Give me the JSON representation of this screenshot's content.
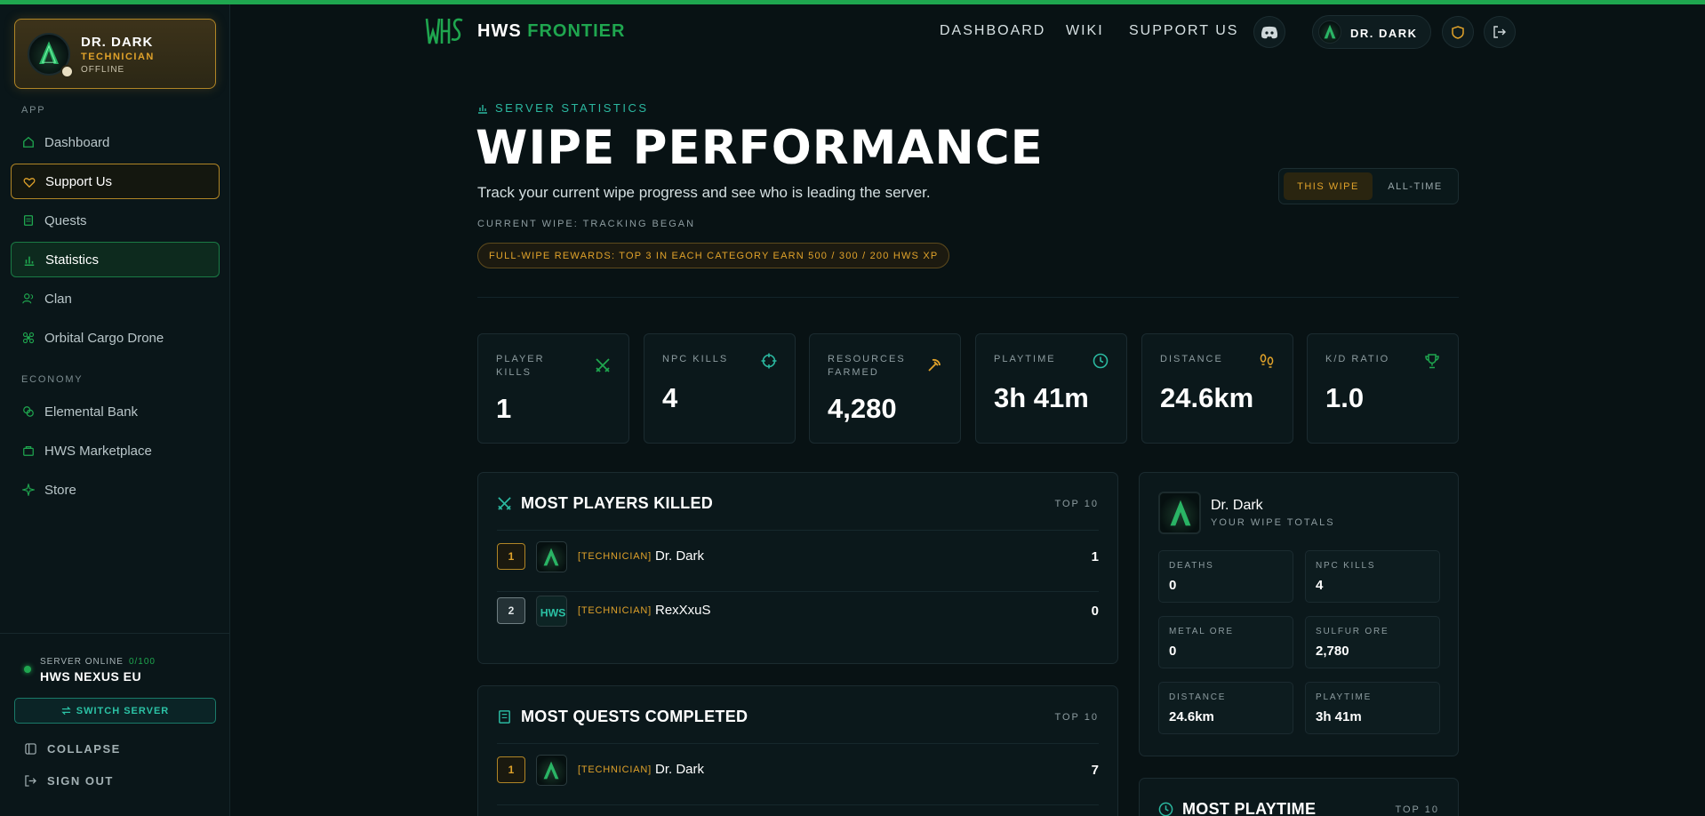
{
  "sidebar": {
    "profile": {
      "name": "DR. DARK",
      "role": "TECHNICIAN",
      "status": "OFFLINE"
    },
    "sections": [
      {
        "label": "APP",
        "items": [
          {
            "label": "Dashboard",
            "icon": "home-icon"
          },
          {
            "label": "Support Us",
            "icon": "heart-icon"
          },
          {
            "label": "Quests",
            "icon": "scroll-icon"
          },
          {
            "label": "Statistics",
            "icon": "bar-chart-icon"
          },
          {
            "label": "Clan",
            "icon": "users-icon"
          },
          {
            "label": "Orbital Cargo Drone",
            "icon": "drone-icon"
          }
        ]
      },
      {
        "label": "ECONOMY",
        "items": [
          {
            "label": "Elemental Bank",
            "icon": "coins-icon"
          },
          {
            "label": "HWS Marketplace",
            "icon": "bag-icon"
          },
          {
            "label": "Store",
            "icon": "sparkle-icon"
          }
        ]
      }
    ],
    "server": {
      "status": "SERVER ONLINE",
      "count": "0/100",
      "name": "HWS NEXUS EU",
      "switch_label": "SWITCH SERVER"
    },
    "collapse_label": "COLLAPSE",
    "signout_label": "SIGN OUT"
  },
  "topnav": {
    "logo_text": "HWS",
    "logo_accent": "FRONTIER",
    "links": [
      "DASHBOARD",
      "WIKI",
      "SUPPORT US"
    ],
    "user_name": "DR. DARK"
  },
  "header": {
    "eyebrow": "SERVER STATISTICS",
    "title": "WIPE PERFORMANCE",
    "subtitle": "Track your current wipe progress and see who is leading the server.",
    "tracking": "CURRENT WIPE: TRACKING BEGAN",
    "rewards": "FULL-WIPE REWARDS: TOP 3 IN EACH CATEGORY EARN 500 / 300 / 200 HWS XP",
    "toggle": {
      "active": "THIS WIPE",
      "inactive": "ALL-TIME"
    }
  },
  "stats": [
    {
      "label": "PLAYER KILLS",
      "value": "1",
      "icon": "swords-icon",
      "color": "#1fa64f"
    },
    {
      "label": "NPC KILLS",
      "value": "4",
      "icon": "crosshair-icon",
      "color": "#2bb8a0"
    },
    {
      "label": "RESOURCES FARMED",
      "value": "4,280",
      "icon": "pickaxe-icon",
      "color": "#e0a22a"
    },
    {
      "label": "PLAYTIME",
      "value": "3h 41m",
      "icon": "clock-icon",
      "color": "#2bb8a0"
    },
    {
      "label": "DISTANCE",
      "value": "24.6km",
      "icon": "footprints-icon",
      "color": "#e0a22a"
    },
    {
      "label": "K/D RATIO",
      "value": "1.0",
      "icon": "trophy-icon",
      "color": "#1fa64f"
    }
  ],
  "leaderboards": [
    {
      "title": "MOST PLAYERS KILLED",
      "badge": "TOP 10",
      "icon": "swords-icon",
      "rows": [
        {
          "rank": "1",
          "tag": "[TECHNICIAN]",
          "name": "Dr. Dark",
          "value": "1"
        },
        {
          "rank": "2",
          "tag": "[TECHNICIAN]",
          "name": "RexXxuS",
          "value": "0"
        }
      ]
    },
    {
      "title": "MOST QUESTS COMPLETED",
      "badge": "TOP 10",
      "icon": "scroll-icon",
      "rows": [
        {
          "rank": "1",
          "tag": "[TECHNICIAN]",
          "name": "Dr. Dark",
          "value": "7"
        }
      ]
    }
  ],
  "totals": {
    "name": "Dr. Dark",
    "subtitle": "YOUR WIPE TOTALS",
    "items": [
      {
        "label": "DEATHS",
        "value": "0"
      },
      {
        "label": "NPC KILLS",
        "value": "4"
      },
      {
        "label": "METAL ORE",
        "value": "0"
      },
      {
        "label": "SULFUR ORE",
        "value": "2,780"
      },
      {
        "label": "DISTANCE",
        "value": "24.6km"
      },
      {
        "label": "PLAYTIME",
        "value": "3h 41m"
      }
    ]
  },
  "playtime_panel": {
    "title": "MOST PLAYTIME",
    "badge": "TOP 10"
  },
  "colors": {
    "accent_green": "#1fa64f",
    "accent_gold": "#e0a22a",
    "accent_teal": "#2bb8a0",
    "background": "#081214"
  }
}
